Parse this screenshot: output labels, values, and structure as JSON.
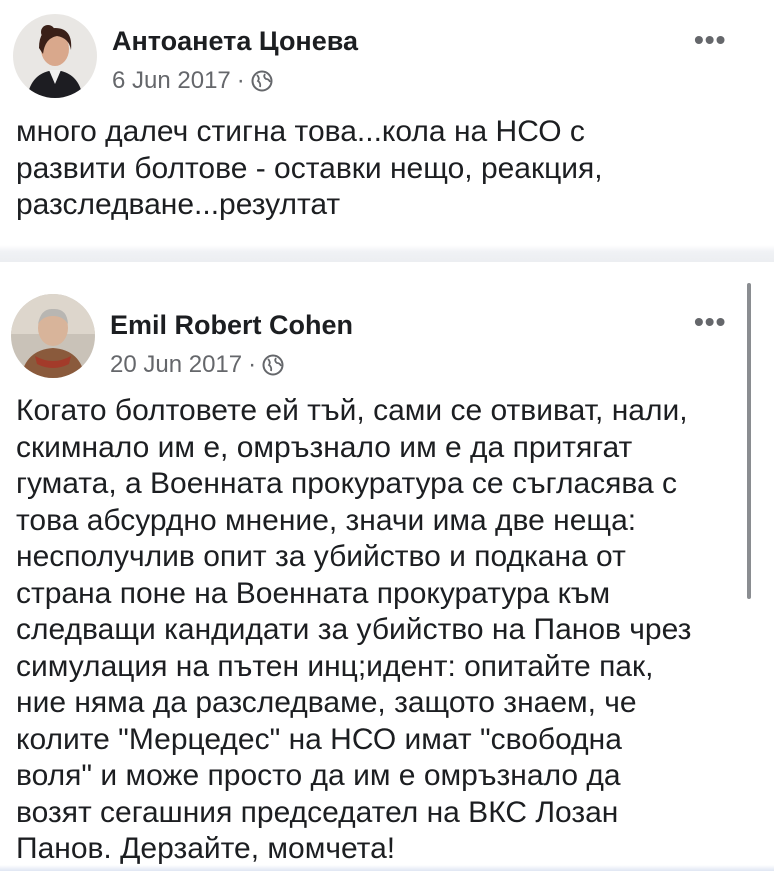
{
  "posts": [
    {
      "author": "Антоанета Цонева",
      "date": "6 Jun 2017",
      "separator": "·",
      "privacy_icon": "globe-icon",
      "more_label": "•••",
      "text": "много далеч стигна това...кола на НСО с\nразвити болтове - оставки нещо, реакция,\nразследване...резултат"
    },
    {
      "author": "Emil Robert Cohen",
      "date": "20 Jun 2017",
      "separator": "·",
      "privacy_icon": "globe-icon",
      "more_label": "•••",
      "text": "Когато болтовете ей тъй, сами се отвиват, нали,\nскимнало им е, омръзнало им е да притягат\nгумата, а Военната прокуратура се съгласява с\nтова абсурдно мнение, значи има две неща:\nнесполучлив опит за убийство и подкана от\nстрана поне на Военната прокуратура към\nследващи кандидати за убийство на Панов чрез\nсимулация на пътен инц;идент: опитайте пак,\nние няма да разследваме, защото знаем, че\nколите \"Мерцедес\" на НСО имат \"свободна\nволя\" и може просто да им е омръзнало да\nвозят сегашния председател на ВКС Лозан\nПанов. Дерзайте, момчета!"
    }
  ]
}
